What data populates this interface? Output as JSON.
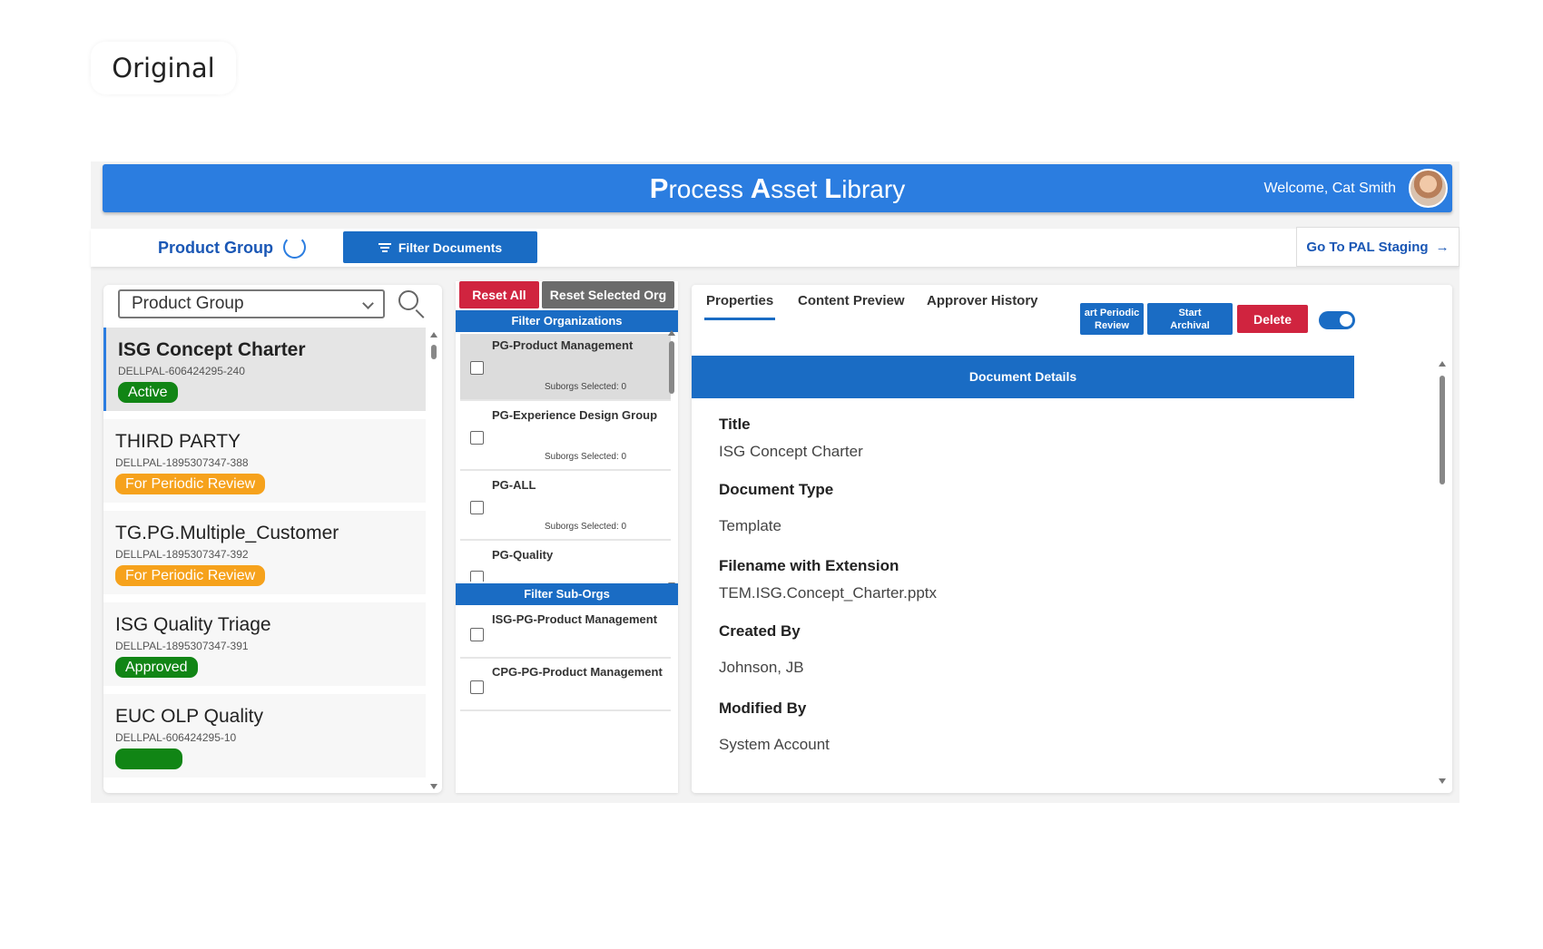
{
  "caption": "Original",
  "header": {
    "title_parts": [
      {
        "text": "P",
        "big": true
      },
      {
        "text": "rocess ",
        "big": false
      },
      {
        "text": "A",
        "big": true
      },
      {
        "text": "sset ",
        "big": false
      },
      {
        "text": "L",
        "big": true
      },
      {
        "text": "ibrary",
        "big": false
      }
    ],
    "welcome": "Welcome, Cat Smith"
  },
  "toolbar": {
    "product_group": "Product Group",
    "filter_documents": "Filter Documents",
    "go_staging": "Go To PAL Staging",
    "go_staging_arrow": "→"
  },
  "left": {
    "select_value": "Product Group",
    "documents": [
      {
        "title": "ISG Concept Charter",
        "id": "DELLPAL-606424295-240",
        "status": "Active",
        "status_color": "green",
        "selected": true
      },
      {
        "title": "THIRD PARTY",
        "id": "DELLPAL-1895307347-388",
        "status": "For Periodic Review",
        "status_color": "orange",
        "selected": false
      },
      {
        "title": "TG.PG.Multiple_Customer",
        "id": "DELLPAL-1895307347-392",
        "status": "For Periodic Review",
        "status_color": "orange",
        "selected": false
      },
      {
        "title": "ISG Quality Triage",
        "id": "DELLPAL-1895307347-391",
        "status": "Approved",
        "status_color": "green",
        "selected": false
      },
      {
        "title": "EUC OLP Quality",
        "id": "DELLPAL-606424295-10",
        "status": "",
        "status_color": "green",
        "selected": false
      }
    ]
  },
  "middle": {
    "reset_all": "Reset All",
    "reset_selected_org": "Reset Selected Org",
    "filter_orgs_title": "Filter Organizations",
    "orgs": [
      {
        "name": "PG-Product Management",
        "suborgs": "Suborgs Selected: 0",
        "selected": true
      },
      {
        "name": "PG-Experience Design Group",
        "suborgs": "Suborgs Selected: 0",
        "selected": false
      },
      {
        "name": "PG-ALL",
        "suborgs": "Suborgs Selected: 0",
        "selected": false
      },
      {
        "name": "PG-Quality",
        "suborgs": "",
        "selected": false
      }
    ],
    "filter_suborgs_title": "Filter Sub-Orgs",
    "suborgs": [
      {
        "name": "ISG-PG-Product Management"
      },
      {
        "name": "CPG-PG-Product Management"
      }
    ]
  },
  "right": {
    "tabs": [
      "Properties",
      "Content Preview",
      "Approver History"
    ],
    "active_tab": "Properties",
    "start_periodic_review_line1": "art Periodic",
    "start_periodic_review_line2": "Review",
    "start_archival_line1": "Start",
    "start_archival_line2": "Archival",
    "delete": "Delete",
    "toggle_on": true,
    "details_title": "Document Details",
    "fields": [
      {
        "label": "Title",
        "value": "ISG Concept Charter"
      },
      {
        "label": "Document Type",
        "value": "Template"
      },
      {
        "label": "Filename with Extension",
        "value": "TEM.ISG.Concept_Charter.pptx"
      },
      {
        "label": "Created By",
        "value": "Johnson, JB"
      },
      {
        "label": "Modified By",
        "value": "System Account"
      }
    ]
  },
  "colors": {
    "header_blue": "#2b7de0",
    "primary_blue": "#1a6cc4",
    "danger_red": "#d0243f",
    "active_green": "#118515",
    "review_orange": "#f6a21c"
  }
}
